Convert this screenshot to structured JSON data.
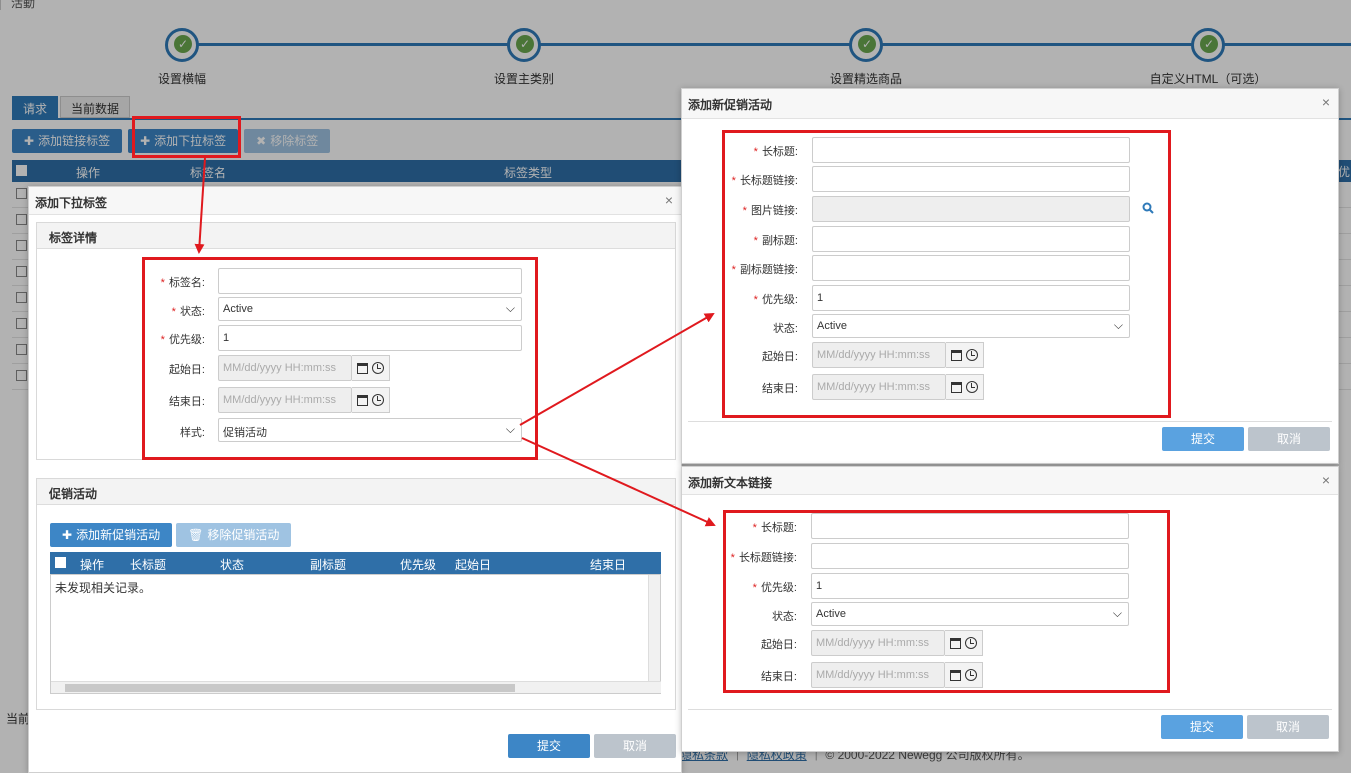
{
  "breadcrumb": "活動",
  "steps": [
    {
      "label": "设置横幅"
    },
    {
      "label": "设置主类别"
    },
    {
      "label": "设置精选商品"
    },
    {
      "label": "自定义HTML（可选）"
    }
  ],
  "tabs": [
    {
      "label": "请求"
    },
    {
      "label": "当前数据"
    }
  ],
  "toolbar": {
    "add_link_tab": "添加链接标签",
    "add_dropdown_tab": "添加下拉标签",
    "remove_tab": "移除标签"
  },
  "main_grid": {
    "columns": [
      "操作",
      "标签名",
      "标签类型"
    ],
    "right_edge": "优"
  },
  "bg_footer": "当前",
  "copyright": {
    "link1": "隐私条款",
    "link2": "隐私权政策",
    "text": "© 2000-2022 Newegg 公司版权所有。"
  },
  "dropdown_dialog": {
    "title": "添加下拉标签",
    "detail_panel_title": "标签详情",
    "fields": {
      "tag_name_label": "标签名:",
      "status_label": "状态:",
      "status_value": "Active",
      "priority_label": "优先级:",
      "priority_value": "1",
      "start_label": "起始日:",
      "end_label": "结束日:",
      "date_placeholder": "MM/dd/yyyy HH:mm:ss",
      "style_label": "样式:",
      "style_value": "促销活动"
    },
    "promo_panel_title": "促销活动",
    "add_promo": "添加新促销活动",
    "remove_promo": "移除促销活动",
    "promo_columns": [
      "操作",
      "长标题",
      "状态",
      "副标题",
      "优先级",
      "起始日",
      "结束日"
    ],
    "empty_text": "未发现相关记录。",
    "submit": "提交",
    "cancel": "取消"
  },
  "promo_dialog": {
    "title": "添加新促销活动",
    "long_title_label": "长标题:",
    "long_title_link_label": "长标题链接:",
    "image_link_label": "图片链接:",
    "subtitle_label": "副标题:",
    "subtitle_link_label": "副标题链接:",
    "priority_label": "优先级:",
    "priority_value": "1",
    "status_label": "状态:",
    "status_value": "Active",
    "start_label": "起始日:",
    "end_label": "结束日:",
    "date_placeholder": "MM/dd/yyyy HH:mm:ss",
    "submit": "提交",
    "cancel": "取消"
  },
  "text_link_dialog": {
    "title": "添加新文本链接",
    "long_title_label": "长标题:",
    "long_title_link_label": "长标题链接:",
    "priority_label": "优先级:",
    "priority_value": "1",
    "status_label": "状态:",
    "status_value": "Active",
    "start_label": "起始日:",
    "end_label": "结束日:",
    "date_placeholder": "MM/dd/yyyy HH:mm:ss",
    "submit": "提交",
    "cancel": "取消"
  },
  "colors": {
    "primary": "#3d86c6",
    "grid_header": "#2f6fa8",
    "highlight": "#e0191e",
    "required": "#d22222"
  }
}
